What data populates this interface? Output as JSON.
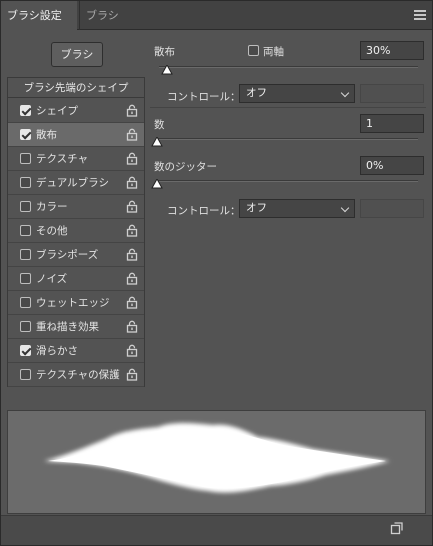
{
  "tabs": [
    {
      "label": "ブラシ設定"
    },
    {
      "label": "ブラシ"
    }
  ],
  "left": {
    "presets_button": "ブラシ",
    "header": "ブラシ先端のシェイプ",
    "items": [
      {
        "label": "シェイプ",
        "checked": true
      },
      {
        "label": "散布",
        "checked": true,
        "selected": true
      },
      {
        "label": "テクスチャ",
        "checked": false
      },
      {
        "label": "デュアルブラシ",
        "checked": false
      },
      {
        "label": "カラー",
        "checked": false
      },
      {
        "label": "その他",
        "checked": false
      },
      {
        "label": "ブラシポーズ",
        "checked": false
      },
      {
        "label": "ノイズ",
        "checked": false
      },
      {
        "label": "ウェットエッジ",
        "checked": false
      },
      {
        "label": "重ね描き効果",
        "checked": false
      },
      {
        "label": "滑らかさ",
        "checked": true
      },
      {
        "label": "テクスチャの保護",
        "checked": false
      }
    ]
  },
  "scatter": {
    "label": "散布",
    "both_axes_label": "両軸",
    "value": "30%",
    "level": 0.03,
    "control_label": "コントロール：",
    "control_value": "オフ"
  },
  "count": {
    "label": "数",
    "value": "1",
    "level": 0
  },
  "count_jitter": {
    "label": "数のジッター",
    "value": "0%",
    "level": 0,
    "control_label": "コントロール：",
    "control_value": "オフ"
  },
  "icons": {
    "panel_menu": "hamburger-icon",
    "lock": "lock-icon",
    "new_brush": "new-brush-icon",
    "dropdown": "chevron-down-icon"
  },
  "colors": {
    "panel": "#535353",
    "preview_bg": "#6b6b6b",
    "stroke": "#ffffff"
  }
}
